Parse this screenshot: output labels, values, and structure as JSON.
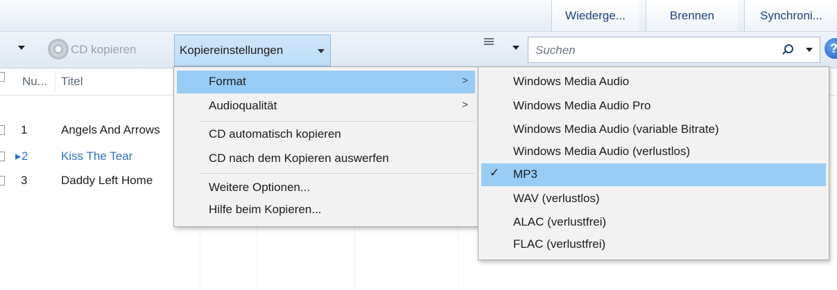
{
  "tabs": [
    {
      "label": "Wiederge..."
    },
    {
      "label": "Brennen"
    },
    {
      "label": "Synchroni..."
    }
  ],
  "toolbar": {
    "cd_copy_label": "CD kopieren",
    "copy_settings_label": "Kopiereinstellungen",
    "search_placeholder": "Suchen"
  },
  "columns": [
    {
      "label": "Nu..."
    },
    {
      "label": "Titel"
    }
  ],
  "tracks": [
    {
      "number": "1",
      "title": "Angels And Arrows",
      "color": "#1e1e1e"
    },
    {
      "number": "2",
      "title": "Kiss The Tear",
      "color": "#2f6fc4"
    },
    {
      "number": "3",
      "title": "Daddy Left Home",
      "color": "#1e1e1e"
    }
  ],
  "copy_menu": {
    "items": [
      {
        "label": "Format",
        "submenu": true,
        "highlighted": true
      },
      {
        "label": "Audioqualität",
        "submenu": true
      },
      {
        "label": "CD automatisch kopieren"
      },
      {
        "label": "CD nach dem Kopieren auswerfen"
      },
      {
        "label": "Weitere Optionen..."
      },
      {
        "label": "Hilfe beim Kopieren..."
      }
    ]
  },
  "format_menu": {
    "selected": "MP3",
    "items": [
      {
        "label": "Windows Media Audio"
      },
      {
        "label": "Windows Media Audio Pro"
      },
      {
        "label": "Windows Media Audio (variable Bitrate)"
      },
      {
        "label": "Windows Media Audio (verlustlos)"
      },
      {
        "label": "MP3",
        "checked": true
      },
      {
        "label": "WAV (verlustlos)"
      },
      {
        "label": "ALAC (verlustfrei)"
      },
      {
        "label": "FLAC (verlustfrei)"
      }
    ]
  },
  "colors": {
    "highlight": "#99ccf5",
    "accent_text": "#2f6fc4"
  }
}
